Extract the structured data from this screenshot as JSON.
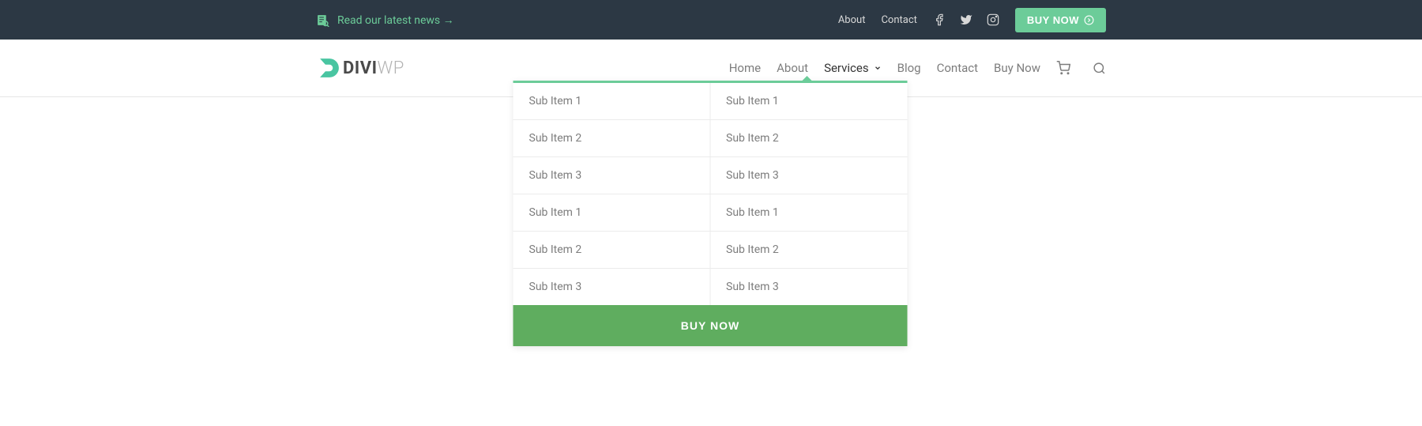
{
  "topbar": {
    "news_text": "Read our latest news →",
    "links": [
      "About",
      "Contact"
    ],
    "buy_label": "BUY NOW"
  },
  "logo": {
    "part1": "DIVI",
    "part2": "WP"
  },
  "nav": {
    "items": [
      {
        "label": "Home",
        "active": false,
        "has_children": false
      },
      {
        "label": "About",
        "active": false,
        "has_children": false
      },
      {
        "label": "Services",
        "active": true,
        "has_children": true
      },
      {
        "label": "Blog",
        "active": false,
        "has_children": false
      },
      {
        "label": "Contact",
        "active": false,
        "has_children": false
      },
      {
        "label": "Buy Now",
        "active": false,
        "has_children": false
      }
    ]
  },
  "dropdown": {
    "col1": [
      "Sub Item 1",
      "Sub Item 2",
      "Sub Item 3",
      "Sub Item 1",
      "Sub Item 2",
      "Sub Item 3"
    ],
    "col2": [
      "Sub Item 1",
      "Sub Item 2",
      "Sub Item 3",
      "Sub Item 1",
      "Sub Item 2",
      "Sub Item 3"
    ],
    "cta": "BUY NOW"
  },
  "colors": {
    "accent": "#6ccc99",
    "topbar_bg": "#2c3844",
    "cta_green": "#5fad5f"
  }
}
